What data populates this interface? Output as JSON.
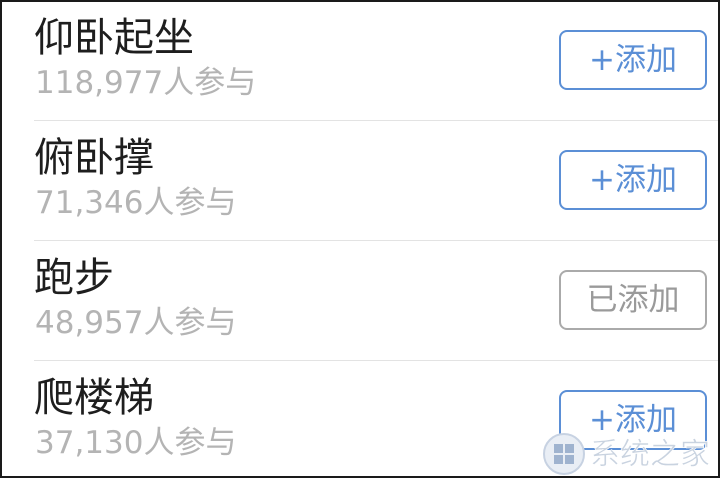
{
  "sports": [
    {
      "name": "仰卧起坐",
      "participants": "118,977人参与",
      "action_label": "+添加",
      "added": false
    },
    {
      "name": "俯卧撑",
      "participants": "71,346人参与",
      "action_label": "+添加",
      "added": false
    },
    {
      "name": "跑步",
      "participants": "48,957人参与",
      "action_label": "已添加",
      "added": true
    },
    {
      "name": "爬楼梯",
      "participants": "37,130人参与",
      "action_label": "+添加",
      "added": false
    }
  ],
  "watermark": {
    "text": "系统之家",
    "icon": "windows-logo-icon"
  },
  "colors": {
    "accent": "#5b8fd6",
    "added_border": "#aaaaaa",
    "title": "#1e1e1e",
    "subtitle": "#b4b4b4"
  }
}
